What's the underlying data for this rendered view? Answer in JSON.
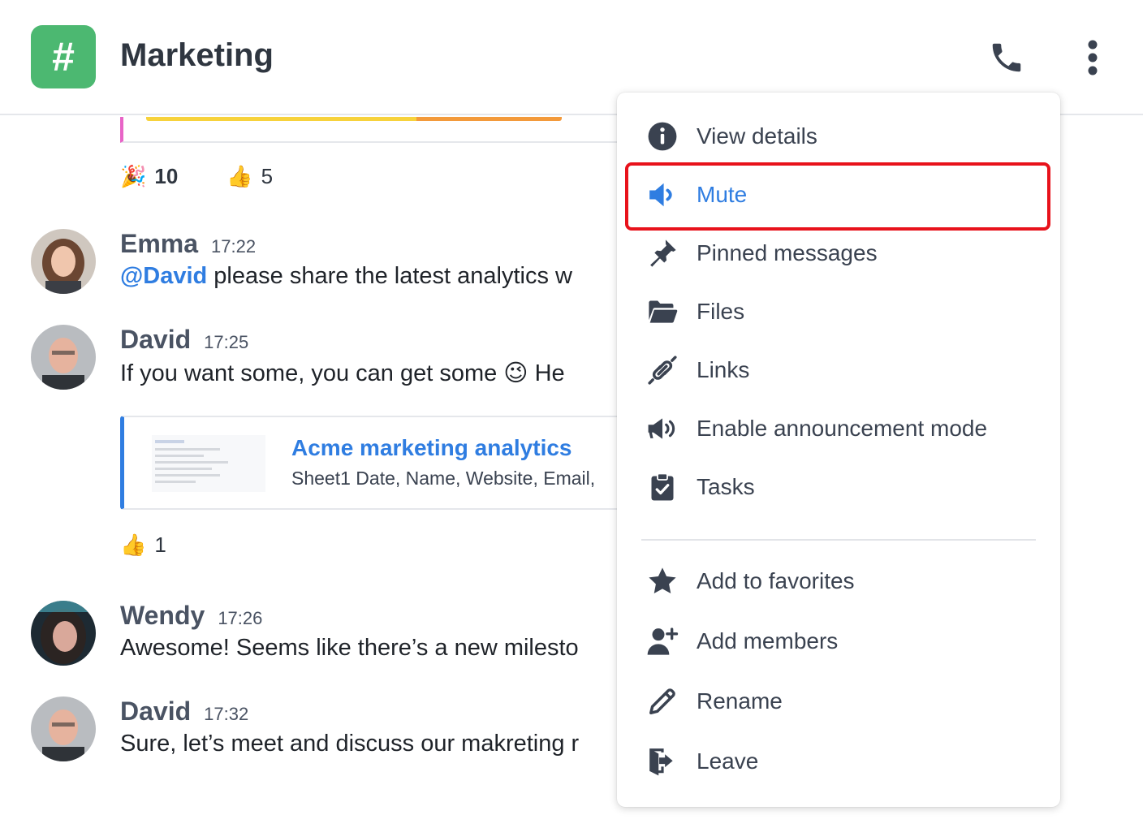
{
  "header": {
    "channel_icon": "#",
    "title": "Marketing",
    "call_icon": "phone-icon",
    "more_icon": "more-vertical-icon"
  },
  "colors": {
    "brand_green": "#4cb871",
    "accent_blue": "#2f7de1",
    "highlight_red": "#e8121b"
  },
  "reactions_top": [
    {
      "emoji": "🎉",
      "count": "10"
    },
    {
      "emoji": "👍",
      "count": "5"
    }
  ],
  "messages": [
    {
      "author": "Emma",
      "time": "17:22",
      "mention": "@David",
      "text": " please share the latest analytics w"
    },
    {
      "author": "David",
      "time": "17:25",
      "text": "If you want some, you can get some 😉 He"
    },
    {
      "author": "Wendy",
      "time": "17:26",
      "text": "Awesome! Seems like there’s a new milesto"
    },
    {
      "author": "David",
      "time": "17:32",
      "text": "Sure, let’s meet and discuss our makreting r"
    }
  ],
  "link_preview": {
    "title": "Acme marketing analytics",
    "description": "Sheet1 Date, Name, Website, Email,"
  },
  "reactions_david": [
    {
      "emoji": "👍",
      "count": "1"
    }
  ],
  "menu": {
    "items": [
      {
        "label": "View details",
        "icon": "info-icon"
      },
      {
        "label": "Mute",
        "icon": "speaker-icon"
      },
      {
        "label": "Pinned messages",
        "icon": "pin-icon"
      },
      {
        "label": "Files",
        "icon": "folder-icon"
      },
      {
        "label": "Links",
        "icon": "link-icon"
      },
      {
        "label": "Enable announcement mode",
        "icon": "megaphone-icon"
      },
      {
        "label": "Tasks",
        "icon": "clipboard-check-icon"
      },
      {
        "label": "Add to favorites",
        "icon": "star-icon"
      },
      {
        "label": "Add members",
        "icon": "add-user-icon"
      },
      {
        "label": "Rename",
        "icon": "pencil-icon"
      },
      {
        "label": "Leave",
        "icon": "leave-icon"
      }
    ]
  }
}
